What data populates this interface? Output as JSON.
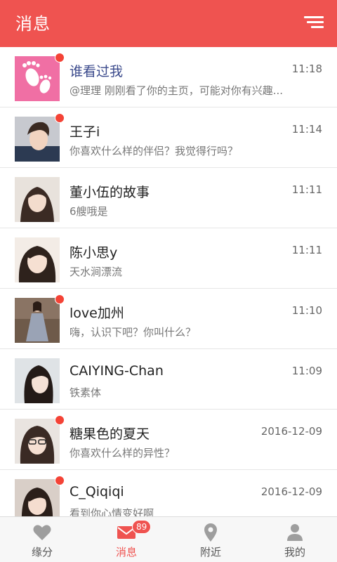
{
  "header": {
    "title": "消息",
    "menu_icon": "menu-lines-icon"
  },
  "messages": [
    {
      "name": "谁看过我",
      "text": "@理理 刚刚看了你的主页，可能对你有兴趣...",
      "time": "11:18"
    },
    {
      "name": "王子i",
      "text": "你喜欢什么样的伴侣？我觉得行吗？",
      "time": "11:14"
    },
    {
      "name": "董小伍的故事",
      "text": "6艘哦是",
      "time": "11:11"
    },
    {
      "name": "陈小思y",
      "text": "天水涧漂流",
      "time": "11:11"
    },
    {
      "name": "love加州",
      "text": "嗨，认识下吧？你叫什么？",
      "time": "11:10"
    },
    {
      "name": "CAIYING-Chan",
      "text": "铁素体",
      "time": "11:09"
    },
    {
      "name": "糖果色的夏天",
      "text": "你喜欢什么样的异性？",
      "time": "2016-12-09"
    },
    {
      "name": "C_Qiqiqi",
      "text": "看到你心情变好啊",
      "time": "2016-12-09"
    }
  ],
  "tabs": [
    {
      "label": "缘分",
      "icon": "heart-icon"
    },
    {
      "label": "消息",
      "icon": "mail-icon",
      "badge": "89"
    },
    {
      "label": "附近",
      "icon": "location-pin-icon"
    },
    {
      "label": "我的",
      "icon": "person-icon"
    }
  ],
  "colors": {
    "accent": "#ef5350",
    "unread_dot": "#f44336",
    "visitor_avatar_bg": "#f06fa4"
  }
}
